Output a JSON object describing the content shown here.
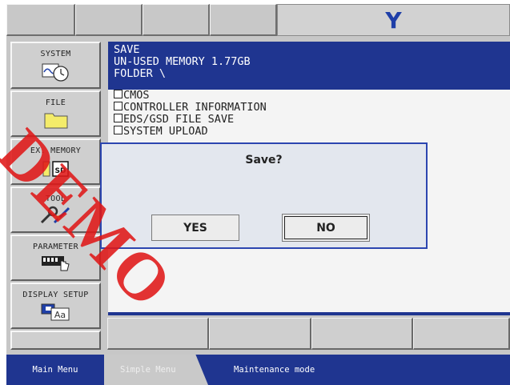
{
  "top_bar": {
    "tabs": [
      "",
      "",
      "",
      ""
    ],
    "active_tab": "Y"
  },
  "left_menu": [
    {
      "label": "SYSTEM",
      "icon": "system-clock-icon"
    },
    {
      "label": "FILE",
      "icon": "folder-icon"
    },
    {
      "label": "EX. MEMORY",
      "icon": "sd-card-icon"
    },
    {
      "label": "TOOL",
      "icon": "tool-wrench-icon"
    },
    {
      "label": "PARAMETER",
      "icon": "parameter-hand-icon"
    },
    {
      "label": "DISPLAY SETUP",
      "icon": "display-setup-icon"
    }
  ],
  "main": {
    "title": "SAVE",
    "memory_line": "UN-USED MEMORY  1.77GB",
    "folder_line": "FOLDER \\",
    "items": [
      "CMOS",
      "CONTROLLER INFORMATION",
      "EDS/GSD FILE SAVE",
      "SYSTEM UPLOAD"
    ]
  },
  "dialog": {
    "question": "Save?",
    "yes_label": "YES",
    "no_label": "NO"
  },
  "softkeys": [
    "",
    "",
    "",
    ""
  ],
  "status_bar": {
    "main_menu": "Main Menu",
    "simple_menu": "Simple Menu",
    "mode": "Maintenance mode"
  },
  "watermark": "DEMO",
  "colors": {
    "header_blue": "#1f3590",
    "dialog_border": "#2c46b0",
    "y_letter": "#1f3fa8",
    "watermark_red": "#e01818"
  }
}
